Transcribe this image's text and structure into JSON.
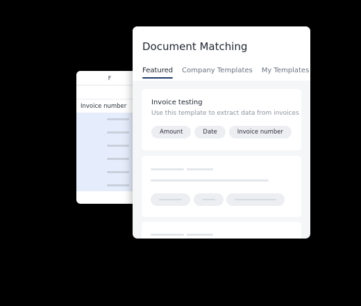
{
  "sheet": {
    "column_letter": "F",
    "column_header": "Invoice number",
    "highlight_color": "#e5ecfb"
  },
  "main": {
    "title": "Document Matching",
    "tabs": [
      {
        "label": "Featured",
        "active": true
      },
      {
        "label": "Company Templates",
        "active": false
      },
      {
        "label": "My Templates",
        "active": false
      }
    ],
    "accent_color": "#1e3a6e",
    "templates": [
      {
        "title": "Invoice testing",
        "description": "Use this template to extract data from invoices",
        "fields": [
          "Amount",
          "Date",
          "Invoice number"
        ]
      }
    ]
  }
}
